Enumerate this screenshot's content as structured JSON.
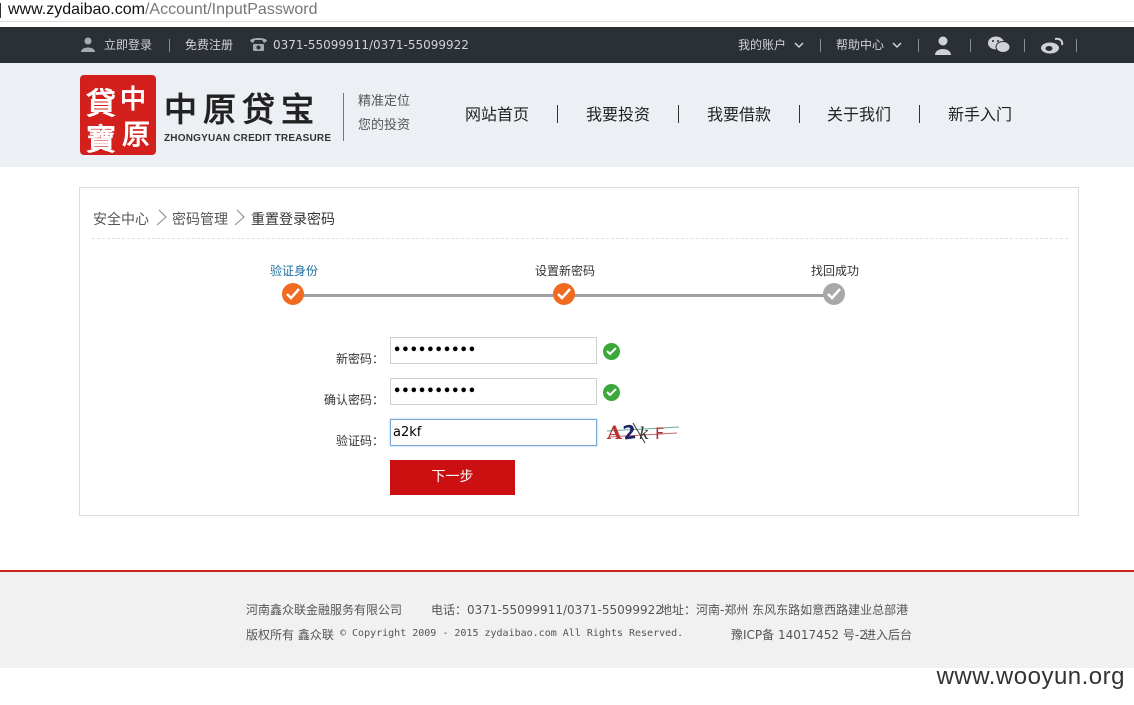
{
  "browser": {
    "url_domain": "www.zydaibao.com",
    "url_path": "/Account/InputPassword"
  },
  "topbar": {
    "login": "立即登录",
    "register": "免费注册",
    "phone": "0371-55099911/0371-55099922",
    "my_account": "我的账户",
    "help_center": "帮助中心",
    "icons": [
      "user-icon",
      "phone-icon",
      "avatar-icon",
      "wechat-icon",
      "weibo-icon",
      "chevron-down-icon"
    ]
  },
  "header": {
    "logo_seal_glyphs": [
      "貸",
      "中",
      "寶",
      "原"
    ],
    "logo_title": "中原贷宝",
    "logo_subtitle": "ZHONGYUAN CREDIT TREASURE",
    "slogan_line1": "精准定位",
    "slogan_line2": "您的投资",
    "nav": [
      "网站首页",
      "我要投资",
      "我要借款",
      "关于我们",
      "新手入门"
    ]
  },
  "breadcrumb": {
    "items": [
      "安全中心",
      "密码管理",
      "重置登录密码"
    ]
  },
  "steps": {
    "items": [
      {
        "label": "验证身份",
        "state": "done"
      },
      {
        "label": "设置新密码",
        "state": "done"
      },
      {
        "label": "找回成功",
        "state": "todo"
      }
    ]
  },
  "form": {
    "new_password_label": "新密码：",
    "new_password_value": "••••••••••",
    "confirm_password_label": "确认密码：",
    "confirm_password_value": "••••••••••",
    "captcha_label": "验证码：",
    "captcha_value": "a2kf",
    "captcha_image_text": "A2kF",
    "submit": "下一步"
  },
  "footer": {
    "company": "河南鑫众联金融服务有限公司",
    "phone": "电话：0371-55099911/0371-55099922",
    "address": "地址：河南-郑州 东风东路如意西路建业总部港",
    "copyright_prefix": "版权所有 鑫众联",
    "copyright": "© Copyright 2009 - 2015 zydaibao.com All Rights Reserved.",
    "icp": "豫ICP备 14017452 号-2",
    "admin": "进入后台"
  },
  "watermark": "www.wooyun.org",
  "colors": {
    "topbar_bg": "#2b2f36",
    "brand_red": "#d4201c",
    "step_done": "#f06a20",
    "step_todo": "#a8a8a8",
    "ok_green": "#3aa83a",
    "button_red": "#cc1012",
    "active_step_text": "#1a6fa3"
  }
}
